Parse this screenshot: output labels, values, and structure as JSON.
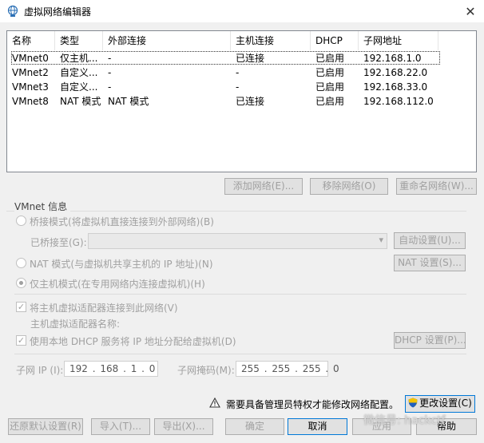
{
  "window": {
    "title": "虚拟网络编辑器",
    "close_glyph": "✕"
  },
  "table": {
    "headers": [
      "名称",
      "类型",
      "外部连接",
      "主机连接",
      "DHCP",
      "子网地址"
    ],
    "rows": [
      [
        "VMnet0",
        "仅主机...",
        "-",
        "已连接",
        "已启用",
        "192.168.1.0"
      ],
      [
        "VMnet2",
        "自定义...",
        "-",
        "-",
        "已启用",
        "192.168.22.0"
      ],
      [
        "VMnet3",
        "自定义...",
        "-",
        "-",
        "已启用",
        "192.168.33.0"
      ],
      [
        "VMnet8",
        "NAT 模式",
        "NAT 模式",
        "已连接",
        "已启用",
        "192.168.112.0"
      ]
    ]
  },
  "table_buttons": {
    "add": "添加网络(E)...",
    "remove": "移除网络(O)",
    "rename": "重命名网络(W)..."
  },
  "vmnet_info": {
    "title": "VMnet 信息",
    "bridge_mode": "桥接模式(将虚拟机直接连接到外部网络)(B)",
    "bridged_to_label": "已桥接至(G):",
    "bridged_to_value": "",
    "auto_settings": "自动设置(U)...",
    "nat_mode": "NAT 模式(与虚拟机共享主机的 IP 地址)(N)",
    "nat_settings": "NAT 设置(S)...",
    "host_only": "仅主机模式(在专用网络内连接虚拟机)(H)",
    "connect_adapter": "将主机虚拟适配器连接到此网络(V)",
    "adapter_name_label": "主机虚拟适配器名称:",
    "use_dhcp": "使用本地 DHCP 服务将 IP 地址分配给虚拟机(D)",
    "dhcp_settings": "DHCP 设置(P)...",
    "subnet_ip_label": "子网 IP (I):",
    "subnet_ip": "192 . 168 . 1 . 0",
    "subnet_mask_label": "子网掩码(M):",
    "subnet_mask": "255 . 255 . 255 . 0"
  },
  "admin_notice": "需要具备管理员特权才能修改网络配置。",
  "buttons": {
    "change_settings": "更改设置(C)",
    "restore_defaults": "还原默认设置(R)",
    "import": "导入(T)...",
    "export": "导出(X)...",
    "ok": "确定",
    "cancel": "取消",
    "apply": "应用",
    "help": "帮助"
  },
  "watermark": "微信号: hackctf",
  "colors": {
    "selection_outline": "#333333",
    "primary_border": "#0078d7",
    "disabled_text": "#a0a0a0",
    "shield_blue": "#1f5fbf",
    "shield_yellow": "#f5c400"
  }
}
